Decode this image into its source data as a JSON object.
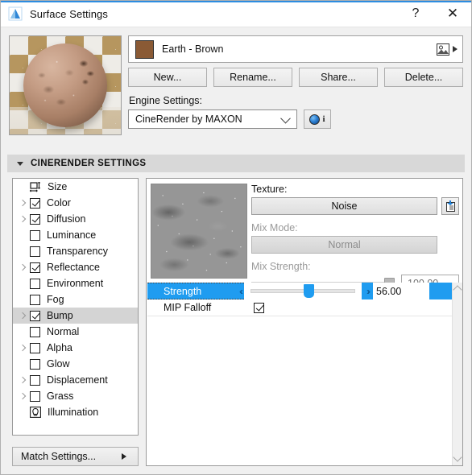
{
  "window": {
    "title": "Surface Settings",
    "app_icon": "archicad-mountain-icon",
    "help_label": "?",
    "close_label": "✕"
  },
  "material": {
    "name": "Earth - Brown",
    "swatch_color": "#8a5a35",
    "picture_icon": "image-icon",
    "expand_arrow": "triangle-right-icon"
  },
  "buttons": {
    "new": "New...",
    "rename": "Rename...",
    "share": "Share...",
    "delete": "Delete..."
  },
  "engine": {
    "label": "Engine Settings:",
    "selected": "CineRender by MAXON",
    "options": [
      "CineRender by MAXON"
    ],
    "info_icon": "sphere-icon",
    "info_label": "i"
  },
  "section": {
    "title": "CINERENDER SETTINGS",
    "collapse_icon": "triangle-down-icon"
  },
  "channels": [
    {
      "label": "Size",
      "checked": null,
      "expandable": false,
      "selected": false,
      "icon": "size-icon"
    },
    {
      "label": "Color",
      "checked": true,
      "expandable": true,
      "selected": false,
      "icon": "checkbox"
    },
    {
      "label": "Diffusion",
      "checked": true,
      "expandable": true,
      "selected": false,
      "icon": "checkbox"
    },
    {
      "label": "Luminance",
      "checked": false,
      "expandable": false,
      "selected": false,
      "icon": "checkbox"
    },
    {
      "label": "Transparency",
      "checked": false,
      "expandable": false,
      "selected": false,
      "icon": "checkbox"
    },
    {
      "label": "Reflectance",
      "checked": true,
      "expandable": true,
      "selected": false,
      "icon": "checkbox"
    },
    {
      "label": "Environment",
      "checked": false,
      "expandable": false,
      "selected": false,
      "icon": "checkbox"
    },
    {
      "label": "Fog",
      "checked": false,
      "expandable": false,
      "selected": false,
      "icon": "checkbox"
    },
    {
      "label": "Bump",
      "checked": true,
      "expandable": true,
      "selected": true,
      "icon": "checkbox"
    },
    {
      "label": "Normal",
      "checked": false,
      "expandable": false,
      "selected": false,
      "icon": "checkbox"
    },
    {
      "label": "Alpha",
      "checked": false,
      "expandable": true,
      "selected": false,
      "icon": "checkbox"
    },
    {
      "label": "Glow",
      "checked": false,
      "expandable": false,
      "selected": false,
      "icon": "checkbox"
    },
    {
      "label": "Displacement",
      "checked": false,
      "expandable": true,
      "selected": false,
      "icon": "checkbox"
    },
    {
      "label": "Grass",
      "checked": false,
      "expandable": true,
      "selected": false,
      "icon": "checkbox"
    },
    {
      "label": "Illumination",
      "checked": null,
      "expandable": false,
      "selected": false,
      "icon": "illumination-icon"
    }
  ],
  "match_settings": {
    "label": "Match Settings...",
    "arrow_icon": "triangle-right-icon"
  },
  "bump_panel": {
    "texture_label": "Texture:",
    "texture_value": "Noise",
    "load_icon": "load-texture-icon",
    "mix_mode_label": "Mix Mode:",
    "mix_mode_value": "Normal",
    "mix_mode_enabled": false,
    "mix_strength_label": "Mix Strength:",
    "mix_strength_value": "100.00",
    "mix_strength_percent": 100,
    "mix_strength_enabled": false,
    "strength_label": "Strength",
    "strength_value": "56.00",
    "strength_percent": 56,
    "strength_selected": true,
    "mip_falloff_label": "MIP Falloff",
    "mip_falloff_checked": true,
    "left_chevron_icon": "chevron-double-left-icon",
    "right_chevron_icon": "chevron-double-right-icon"
  },
  "scrollbar": {
    "up_icon": "chevron-up-icon",
    "down_icon": "chevron-down-icon"
  },
  "colors": {
    "accent": "#1f9cf0",
    "title_accent": "#2d8ce0",
    "selection_gray": "#d4d4d4",
    "swatch_brown": "#8a5a35"
  }
}
